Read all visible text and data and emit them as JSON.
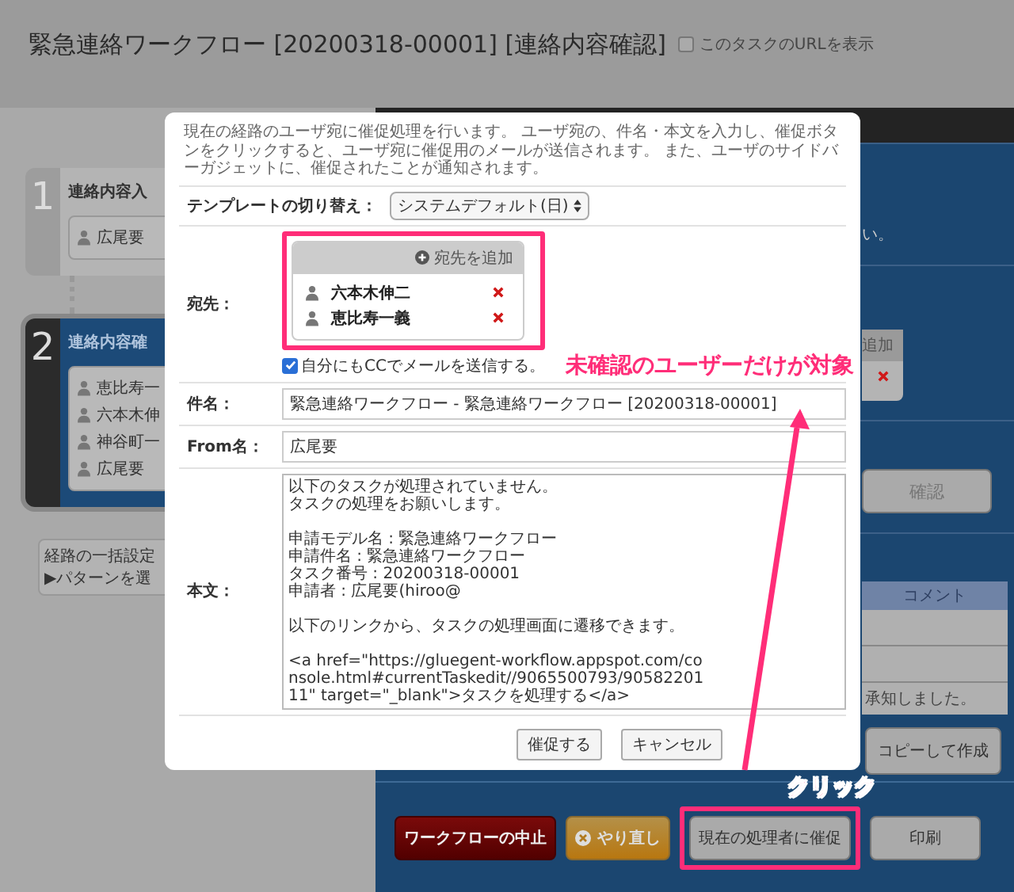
{
  "header": {
    "title": "緊急連絡ワークフロー [20200318-00001] [連絡内容確認]",
    "url_checkbox": {
      "label": "このタスクのURLを表示",
      "checked": false
    }
  },
  "route_steps": [
    {
      "number": "1",
      "name": "連絡内容入",
      "selected": false,
      "members": [
        "広尾要"
      ]
    },
    {
      "number": "2",
      "name": "連絡内容確",
      "selected": true,
      "members": [
        "恵比寿一",
        "六本木伸",
        "神谷町一",
        "広尾要"
      ]
    }
  ],
  "route_settings": {
    "title": "経路の一括設定",
    "link": "▶パターンを選"
  },
  "detail_panel": {
    "message_tail": "い。",
    "recipients_header": "追加",
    "confirm_button": "確認",
    "comments": {
      "header": "コメント",
      "rows": [
        "承知しました。"
      ]
    },
    "copy_button": "コピーして作成"
  },
  "action_bar": [
    {
      "kind": "danger",
      "label": "ワークフローの中止",
      "highlighted": false
    },
    {
      "kind": "warning",
      "label": "やり直し",
      "highlighted": false
    },
    {
      "kind": "normal",
      "label": "現在の処理者に催促",
      "highlighted": true
    },
    {
      "kind": "normal",
      "label": "印刷",
      "highlighted": false
    }
  ],
  "modal": {
    "description": "現在の経路のユーザ宛に催促処理を行います。 ユーザ宛の、件名・本文を入力し、催促ボタンをクリックすると、ユーザ宛に催促用のメールが送信されます。 また、ユーザのサイドバーガジェットに、催促されたことが通知されます。",
    "template": {
      "label": "テンプレートの切り替え：",
      "value": "システムデフォルト(日)"
    },
    "recipients": {
      "label": "宛先：",
      "add_button": "宛先を追加",
      "highlighted": true,
      "items": [
        "六本木伸二",
        "恵比寿一義"
      ]
    },
    "cc_checkbox": {
      "label": "自分にもCCでメールを送信する。",
      "checked": true
    },
    "subject": {
      "label": "件名：",
      "value": "緊急連絡ワークフロー - 緊急連絡ワークフロー [20200318-00001]"
    },
    "from_name": {
      "label": "From名：",
      "value": "広尾要"
    },
    "body": {
      "label": "本文：",
      "paragraphs": [
        [
          "以下のタスクが処理されていません。",
          "タスクの処理をお願いします。"
        ],
        [
          "申請モデル名 : 緊急連絡ワークフロー",
          "申請件名 : 緊急連絡ワークフロー",
          "タスク番号 : 20200318-00001",
          "申請者 : 広尾要(hiroo@"
        ],
        [
          "以下のリンクから、タスクの処理画面に遷移できます。"
        ],
        [
          "<a href=\"https://gluegent-workflow.appspot.com/console.html#currentTaskedit//9065500793/9058220111\" target=\"_blank\">タスクを処理する</a>"
        ]
      ]
    },
    "buttons": [
      "催促する",
      "キャンセル"
    ]
  },
  "annotations": {
    "callout": "未確認のユーザーだけが対象",
    "click_label": "クリック"
  }
}
